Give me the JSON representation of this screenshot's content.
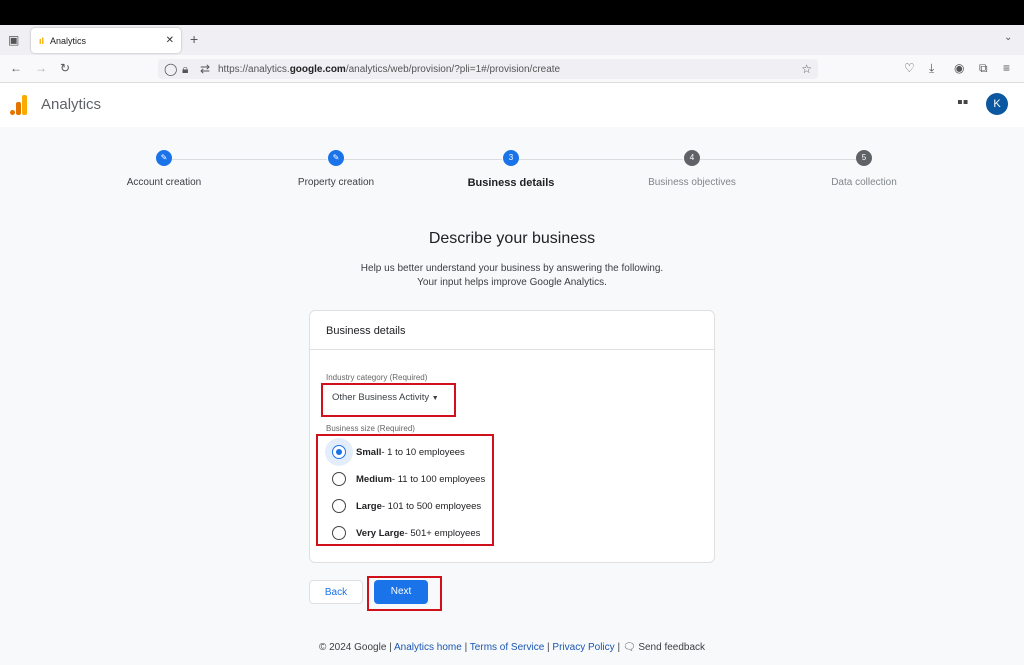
{
  "browser": {
    "tab_title": "Analytics",
    "url_prefix": "https://analytics.",
    "url_domain": "google.com",
    "url_path": "/analytics/web/provision/?pli=1#/provision/create"
  },
  "app": {
    "name": "Analytics",
    "avatar": "K",
    "accent": "#1a73e8"
  },
  "steps": [
    {
      "label": "Account creation",
      "state": "done"
    },
    {
      "label": "Property creation",
      "state": "done"
    },
    {
      "label": "Business details",
      "num": "3",
      "state": "current"
    },
    {
      "label": "Business objectives",
      "num": "4",
      "state": "todo"
    },
    {
      "label": "Data collection",
      "num": "5",
      "state": "todo"
    }
  ],
  "page": {
    "title": "Describe your business",
    "subtitle1": "Help us better understand your business by answering the following.",
    "subtitle2": "Your input helps improve Google Analytics."
  },
  "card": {
    "title": "Business details",
    "industry_label": "Industry category (Required)",
    "industry_value": "Other Business Activity",
    "size_label": "Business size (Required)",
    "sizes": [
      {
        "name": "Small",
        "desc": " - 1 to 10 employees",
        "selected": true
      },
      {
        "name": "Medium",
        "desc": " - 11 to 100 employees",
        "selected": false
      },
      {
        "name": "Large",
        "desc": " - 101 to 500 employees",
        "selected": false
      },
      {
        "name": "Very Large",
        "desc": " - 501+ employees",
        "selected": false
      }
    ]
  },
  "buttons": {
    "back": "Back",
    "next": "Next"
  },
  "footer": {
    "copyright": "© 2024 Google |",
    "home": "Analytics home",
    "terms": "Terms of Service",
    "privacy": "Privacy Policy",
    "feedback": "Send feedback"
  }
}
